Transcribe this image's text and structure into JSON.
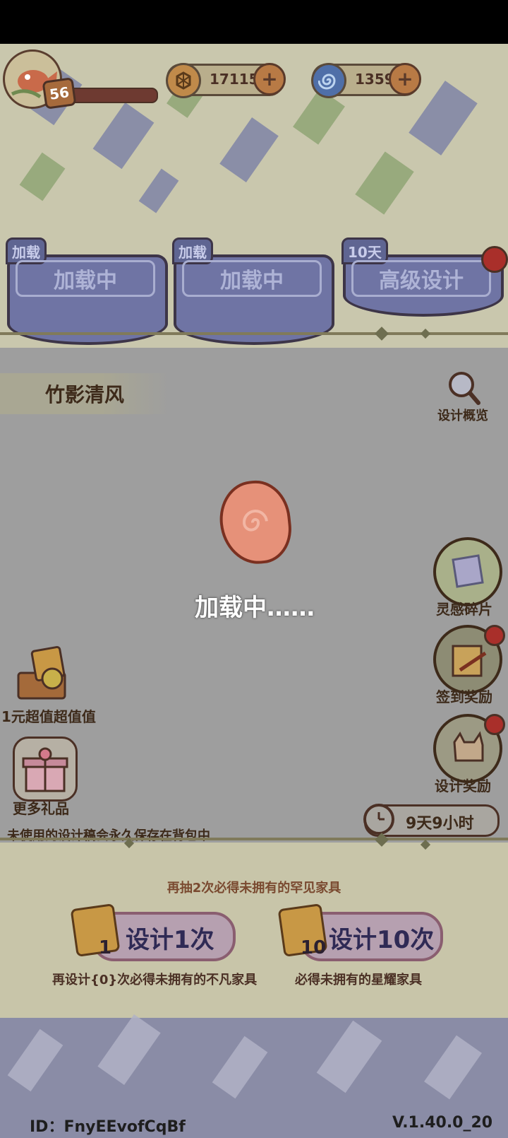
{
  "header": {
    "level": "56",
    "gold": {
      "value": "17115",
      "icon": "gold-coin-icon"
    },
    "gems": {
      "value": "1359",
      "icon": "spiral-gem-icon"
    }
  },
  "tabs": [
    {
      "tag": "加载",
      "label": "加载中"
    },
    {
      "tag": "加载",
      "label": "加载中"
    },
    {
      "tag": "10天",
      "label": "高级设计"
    }
  ],
  "design": {
    "title": "竹影清风",
    "overview_label": "设计概览",
    "loading_text": "加载中……"
  },
  "right_buttons": [
    {
      "label": "灵感碎片",
      "icon": "inspiration-shards-icon"
    },
    {
      "label": "签到奖励",
      "icon": "checkin-calendar-icon"
    },
    {
      "label": "设计奖励",
      "icon": "cat-reward-icon"
    }
  ],
  "left_buttons": [
    {
      "label": "1元超值超值值",
      "icon": "treasure-chest-icon"
    },
    {
      "label": "更多礼品",
      "icon": "gift-box-icon"
    }
  ],
  "hint": "未使用的设计稿会永久保存在背包中",
  "timer": "9天9小时",
  "pity_top": "再抽2次必得未拥有的罕见家具",
  "draw_buttons": [
    {
      "label": "设计1次",
      "count": "1",
      "note": "再设计{0}次必得未拥有的不凡家具"
    },
    {
      "label": "设计10次",
      "count": "10",
      "note": "必得未拥有的星耀家具"
    }
  ],
  "footer": {
    "id": "ID：FnyEEvofCqBf",
    "version": "V.1.40.0_20"
  },
  "colors": {
    "panel_gray": "#9e9e9e",
    "tab_blue": "#6f74a4",
    "red_dot": "#a92f2a",
    "text_brown": "#3d2a1a"
  }
}
